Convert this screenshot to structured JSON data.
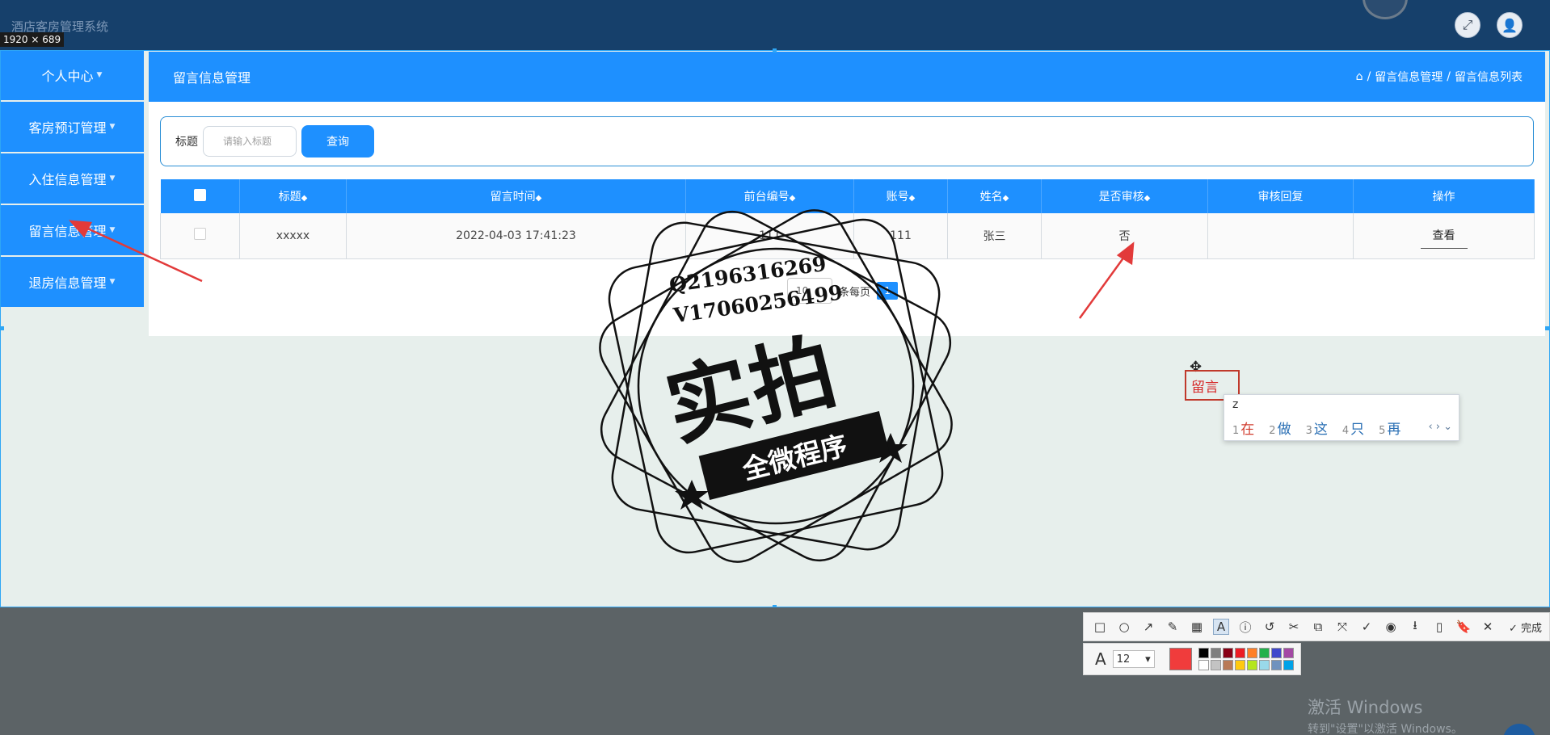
{
  "app": {
    "title": "酒店客房管理系统",
    "size_tip": "1920 × 689"
  },
  "header_buttons": {
    "fullscreen_icon": "⤢",
    "user_icon": "👤"
  },
  "sidebar": {
    "items": [
      {
        "label": "个人中心"
      },
      {
        "label": "客房预订管理"
      },
      {
        "label": "入住信息管理"
      },
      {
        "label": "留言信息管理"
      },
      {
        "label": "退房信息管理"
      }
    ]
  },
  "panel": {
    "title": "留言信息管理",
    "breadcrumb": {
      "home_icon": "⌂",
      "level1": "留言信息管理",
      "level2": "留言信息列表"
    }
  },
  "search": {
    "label": "标题",
    "placeholder": "请输入标题",
    "button": "查询"
  },
  "table": {
    "headers": [
      "标题",
      "留言时间",
      "前台编号",
      "账号",
      "姓名",
      "是否审核",
      "审核回复",
      "操作"
    ],
    "rows": [
      {
        "title": "xxxxx",
        "time": "2022-04-03 17:41:23",
        "desk_no": "111",
        "account": "111",
        "name": "张三",
        "audited": "否",
        "reply": "",
        "action": "查看"
      }
    ]
  },
  "pager": {
    "page_size": "10",
    "per_page_label": "条每页",
    "current_page": "1"
  },
  "stamp": {
    "contact_line1": "Q2196316269",
    "contact_line2": "V17060256499",
    "big_text": "实拍",
    "band_text": "全微程序"
  },
  "annotation": {
    "text": "留言"
  },
  "ime": {
    "composition": "z",
    "candidates": [
      {
        "num": "1",
        "word": "在"
      },
      {
        "num": "2",
        "word": "做"
      },
      {
        "num": "3",
        "word": "这"
      },
      {
        "num": "4",
        "word": "只"
      },
      {
        "num": "5",
        "word": "再"
      }
    ],
    "nav": "‹ › ⌄"
  },
  "toolbar": {
    "tools": [
      "□",
      "○",
      "↗",
      "✎",
      "▦",
      "A",
      "ⓘ",
      "↺",
      "✂",
      "⧉",
      "⤧",
      "✓",
      "◉",
      "⭳",
      "▯",
      "🔖",
      "✕"
    ],
    "done_label": "完成",
    "font_size": "12"
  },
  "colors": {
    "current": "#f03c3c",
    "palette": [
      "#000000",
      "#7f7f7f",
      "#880015",
      "#ed1c24",
      "#ff7f27",
      "#22b14c",
      "#3f48cc",
      "#a349a4",
      "#ffffff",
      "#c3c3c3",
      "#b97a57",
      "#ffc90e",
      "#b5e61d",
      "#99d9ea",
      "#7092be",
      "#00a2e8"
    ]
  },
  "watermark": {
    "line1": "激活 Windows",
    "line2": "转到\"设置\"以激活 Windows。"
  }
}
